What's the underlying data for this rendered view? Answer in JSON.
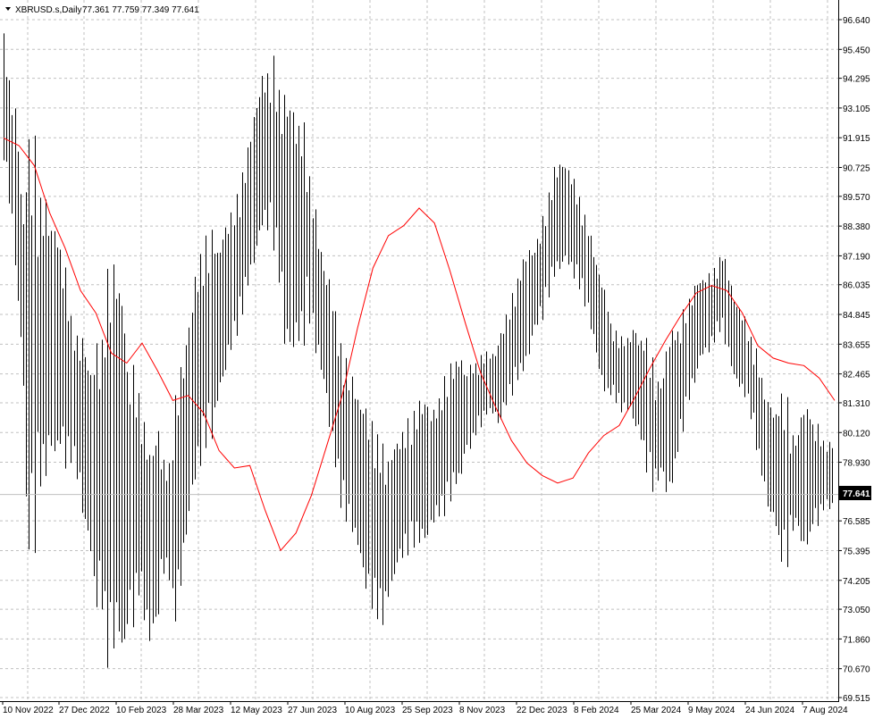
{
  "header": {
    "symbol": "XBRUSD.s,Daily",
    "ohlc": "77.361 77.759 77.349 77.641",
    "dropdown_icon": "triangle-down-icon"
  },
  "price_axis": {
    "labels": [
      "96.640",
      "95.450",
      "94.295",
      "93.105",
      "91.915",
      "90.725",
      "89.570",
      "88.380",
      "87.190",
      "86.035",
      "84.845",
      "83.655",
      "82.465",
      "81.310",
      "80.120",
      "78.930",
      "77.641",
      "76.585",
      "75.395",
      "74.205",
      "73.050",
      "71.860",
      "70.670",
      "69.515"
    ],
    "last_price": "77.641"
  },
  "time_axis": {
    "labels": [
      "10 Nov 2022",
      "27 Dec 2022",
      "10 Feb 2023",
      "28 Mar 2023",
      "12 May 2023",
      "27 Jun 2023",
      "10 Aug 2023",
      "25 Sep 2023",
      "8 Nov 2023",
      "22 Dec 2023",
      "8 Feb 2024",
      "25 Mar 2024",
      "9 May 2024",
      "24 Jun 2024",
      "7 Aug 2024"
    ]
  },
  "colors": {
    "background": "#ffffff",
    "grid": "#c0c0c0",
    "bars": "#000000",
    "moving_average": "#ff0000",
    "last_price_bg": "#000000",
    "last_price_line": "#c0c0c0"
  },
  "chart_data": {
    "type": "line",
    "title": "XBRUSD.s,Daily",
    "xlabel": "",
    "ylabel": "",
    "ylim": [
      69.515,
      96.64
    ],
    "grid": true,
    "legend": "none",
    "x": [
      "10 Nov 2022",
      "27 Dec 2022",
      "10 Feb 2023",
      "28 Mar 2023",
      "12 May 2023",
      "27 Jun 2023",
      "10 Aug 2023",
      "25 Sep 2023",
      "8 Nov 2023",
      "22 Dec 2023",
      "8 Feb 2024",
      "25 Mar 2024",
      "9 May 2024",
      "24 Jun 2024",
      "7 Aug 2024"
    ],
    "series": [
      {
        "kind": "ohlc-bars",
        "values": [
          {
            "high": 96.1,
            "low": 91.0
          },
          {
            "high": 93.4,
            "low": 86.5
          },
          {
            "high": 92.0,
            "low": 75.3
          },
          {
            "high": 89.5,
            "low": 77.8
          },
          {
            "high": 88.9,
            "low": 79.1
          },
          {
            "high": 87.6,
            "low": 79.5
          },
          {
            "high": 84.8,
            "low": 78.9
          },
          {
            "high": 84.2,
            "low": 76.6
          },
          {
            "high": 83.8,
            "low": 73.0
          },
          {
            "high": 86.5,
            "low": 70.4
          },
          {
            "high": 87.0,
            "low": 71.8
          },
          {
            "high": 82.8,
            "low": 72.2
          },
          {
            "high": 81.7,
            "low": 73.6
          },
          {
            "high": 79.5,
            "low": 71.5
          },
          {
            "high": 79.2,
            "low": 74.5
          },
          {
            "high": 81.0,
            "low": 71.9
          },
          {
            "high": 83.2,
            "low": 74.8
          },
          {
            "high": 86.6,
            "low": 78.0
          },
          {
            "high": 88.0,
            "low": 79.5
          },
          {
            "high": 87.5,
            "low": 81.2
          },
          {
            "high": 88.7,
            "low": 83.0
          },
          {
            "high": 90.0,
            "low": 84.3
          },
          {
            "high": 92.5,
            "low": 86.1
          },
          {
            "high": 94.6,
            "low": 88.2
          },
          {
            "high": 95.2,
            "low": 87.4
          },
          {
            "high": 93.9,
            "low": 83.4
          },
          {
            "high": 92.6,
            "low": 83.6
          },
          {
            "high": 91.0,
            "low": 85.1
          },
          {
            "high": 88.1,
            "low": 83.0
          },
          {
            "high": 86.5,
            "low": 80.1
          },
          {
            "high": 83.7,
            "low": 77.1
          },
          {
            "high": 82.5,
            "low": 76.0
          },
          {
            "high": 81.6,
            "low": 74.0
          },
          {
            "high": 80.2,
            "low": 72.8
          },
          {
            "high": 78.8,
            "low": 73.0
          },
          {
            "high": 79.9,
            "low": 74.7
          },
          {
            "high": 80.7,
            "low": 75.2
          },
          {
            "high": 81.5,
            "low": 75.6
          },
          {
            "high": 81.0,
            "low": 76.2
          },
          {
            "high": 82.1,
            "low": 76.5
          },
          {
            "high": 83.0,
            "low": 77.8
          },
          {
            "high": 82.6,
            "low": 79.1
          },
          {
            "high": 82.9,
            "low": 80.0
          },
          {
            "high": 83.4,
            "low": 80.8
          },
          {
            "high": 83.9,
            "low": 80.2
          },
          {
            "high": 85.4,
            "low": 81.3
          },
          {
            "high": 86.9,
            "low": 82.2
          },
          {
            "high": 87.4,
            "low": 83.8
          },
          {
            "high": 88.8,
            "low": 84.6
          },
          {
            "high": 90.8,
            "low": 86.3
          },
          {
            "high": 91.0,
            "low": 86.9
          },
          {
            "high": 89.9,
            "low": 86.2
          },
          {
            "high": 88.6,
            "low": 84.7
          },
          {
            "high": 86.7,
            "low": 82.4
          },
          {
            "high": 84.5,
            "low": 81.6
          },
          {
            "high": 84.0,
            "low": 80.9
          },
          {
            "high": 84.5,
            "low": 80.4
          },
          {
            "high": 84.3,
            "low": 78.9
          },
          {
            "high": 82.1,
            "low": 78.0
          },
          {
            "high": 83.8,
            "low": 77.3
          },
          {
            "high": 84.2,
            "low": 79.3
          },
          {
            "high": 85.5,
            "low": 81.4
          },
          {
            "high": 86.3,
            "low": 83.0
          },
          {
            "high": 86.5,
            "low": 83.5
          },
          {
            "high": 87.6,
            "low": 84.1
          },
          {
            "high": 85.6,
            "low": 82.2
          },
          {
            "high": 84.8,
            "low": 81.5
          },
          {
            "high": 83.5,
            "low": 79.4
          },
          {
            "high": 81.6,
            "low": 76.9
          },
          {
            "high": 81.8,
            "low": 75.0
          },
          {
            "high": 80.0,
            "low": 76.1
          },
          {
            "high": 81.2,
            "low": 75.3
          },
          {
            "high": 80.5,
            "low": 76.4
          },
          {
            "high": 79.8,
            "low": 77.0
          }
        ]
      },
      {
        "kind": "moving-average",
        "values": [
          91.9,
          91.6,
          90.8,
          88.9,
          87.5,
          85.8,
          84.9,
          83.3,
          82.9,
          83.7,
          82.6,
          81.4,
          81.6,
          80.9,
          79.4,
          78.7,
          78.8,
          77.0,
          75.4,
          76.1,
          77.6,
          79.6,
          81.6,
          84.3,
          86.7,
          88.0,
          88.4,
          89.1,
          88.5,
          86.6,
          84.5,
          82.5,
          81.1,
          79.8,
          78.9,
          78.4,
          78.1,
          78.3,
          79.3,
          80.0,
          80.4,
          81.5,
          82.7,
          83.8,
          84.8,
          85.7,
          86.0,
          85.8,
          84.9,
          83.6,
          83.1,
          82.9,
          82.8,
          82.3,
          81.4
        ]
      }
    ]
  }
}
